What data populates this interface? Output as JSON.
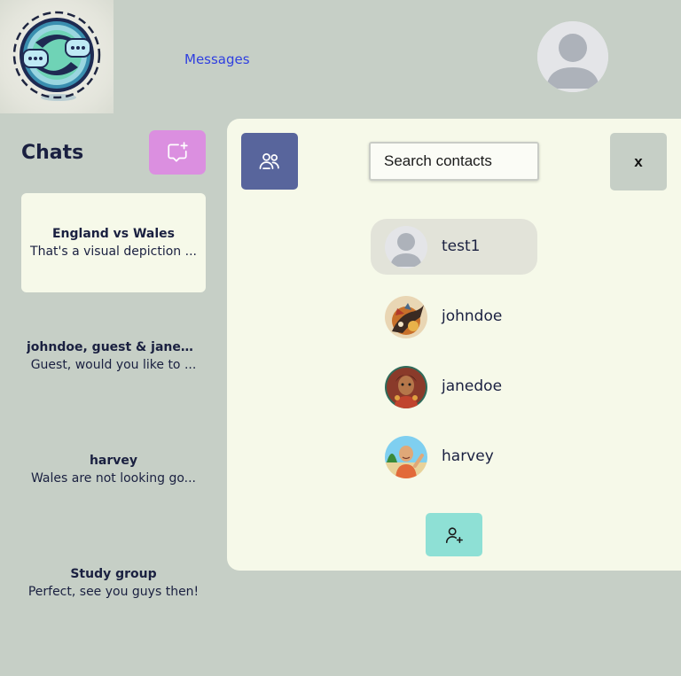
{
  "header": {
    "logo_icon": "chat-exchange-logo",
    "nav_link": "Messages",
    "profile_icon": "user-avatar-placeholder"
  },
  "sidebar": {
    "title": "Chats",
    "new_chat_icon": "new-chat-icon",
    "chats": [
      {
        "name": "England vs Wales",
        "preview": "That's a visual depiction ...",
        "active": true
      },
      {
        "name": "johndoe, guest & janed...",
        "preview": "Guest, would you like to ...",
        "active": false
      },
      {
        "name": "harvey",
        "preview": "Wales are not looking go...",
        "active": false
      },
      {
        "name": "Study group",
        "preview": "Perfect, see you guys then!",
        "active": false
      }
    ]
  },
  "panel": {
    "group_icon": "group-icon",
    "search_placeholder": "Search contacts",
    "close_label": "x",
    "contacts": [
      {
        "name": "test1",
        "avatar": "placeholder",
        "selected": true
      },
      {
        "name": "johndoe",
        "avatar": "dragon-illustration",
        "selected": false
      },
      {
        "name": "janedoe",
        "avatar": "girl-portrait",
        "selected": false
      },
      {
        "name": "harvey",
        "avatar": "beach-man-portrait",
        "selected": false
      }
    ],
    "add_contact_icon": "add-user-icon"
  },
  "colors": {
    "background": "#c6cfc6",
    "panel": "#f6f9e9",
    "link": "#2f3fe0",
    "new_chat_button": "#db8fe0",
    "group_button": "#58659c",
    "add_contact_button": "#8ee0d5",
    "selected_contact": "#e2e3d9"
  }
}
